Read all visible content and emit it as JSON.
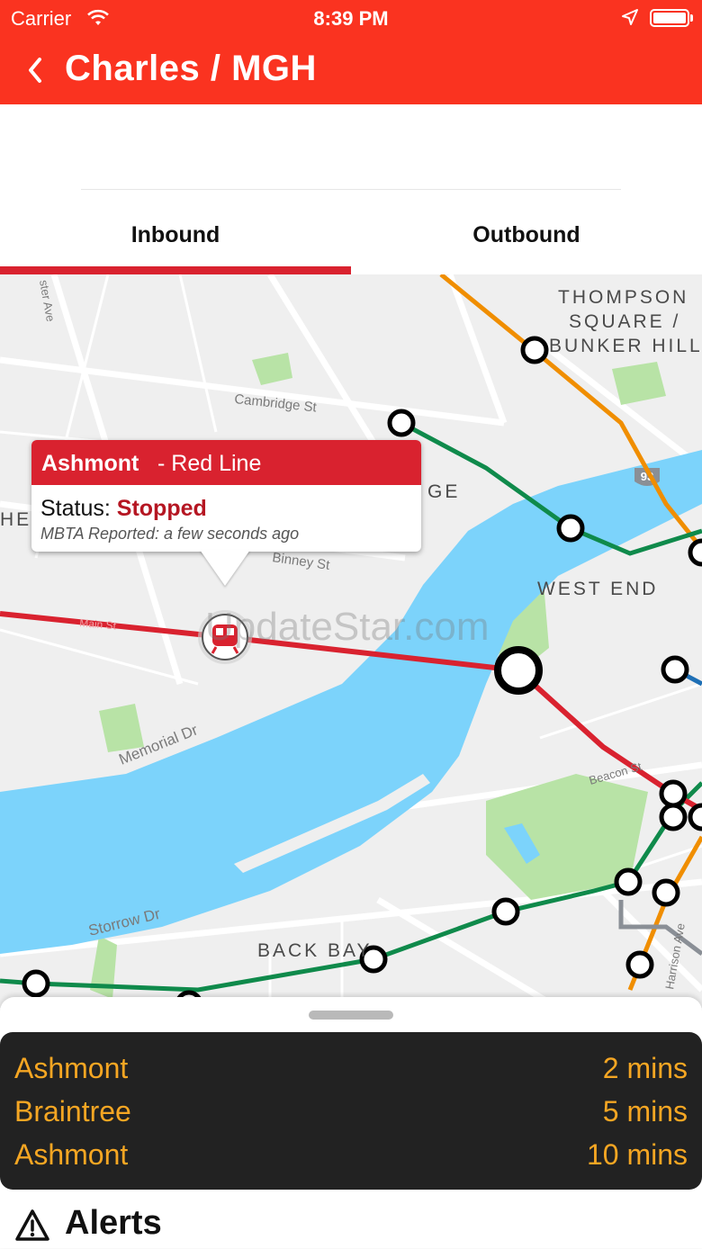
{
  "status_bar": {
    "carrier": "Carrier",
    "time": "8:39 PM"
  },
  "nav": {
    "title": "Charles / MGH"
  },
  "tabs": [
    {
      "label": "Inbound",
      "selected": true
    },
    {
      "label": "Outbound",
      "selected": false
    }
  ],
  "map": {
    "labels": {
      "thompson_1": "THOMPSON",
      "thompson_2": "SQUARE /",
      "thompson_3": "BUNKER HILL",
      "cambridge_st": "Cambridge St",
      "west_end": "WEST END",
      "memorial_dr": "Memorial Dr",
      "storrow_dr": "Storrow Dr",
      "back_bay": "BACK BAY",
      "beacon_st": "Beacon St",
      "main_st": "Main St",
      "binney_st": "Binney St",
      "harrison_ave": "Harrison Ave",
      "ge_fragment": "GE",
      "he_fragment": "HE",
      "shield_93": "93",
      "ave_fragment": "ster Ave"
    },
    "colors": {
      "red_line": "#d9222f",
      "green_line": "#0f8a4b",
      "orange_line": "#f08e00",
      "blue_line": "#1e6fb5",
      "water": "#7cd3fb",
      "park": "#b8e3a6"
    }
  },
  "callout": {
    "destination": "Ashmont",
    "line": "- Red Line",
    "status_label": "Status:",
    "status_value": "Stopped",
    "reported": "MBTA Reported: a few seconds ago"
  },
  "watermark": "UpdateStar.com",
  "predictions": [
    {
      "destination": "Ashmont",
      "eta": "2 mins"
    },
    {
      "destination": "Braintree",
      "eta": "5 mins"
    },
    {
      "destination": "Ashmont",
      "eta": "10 mins"
    }
  ],
  "alerts": {
    "label": "Alerts"
  },
  "icons": {
    "back": "chevron-left-icon",
    "wifi": "wifi-icon",
    "location": "location-arrow-icon",
    "battery": "battery-icon",
    "train": "train-icon",
    "warning": "warning-triangle-icon"
  }
}
